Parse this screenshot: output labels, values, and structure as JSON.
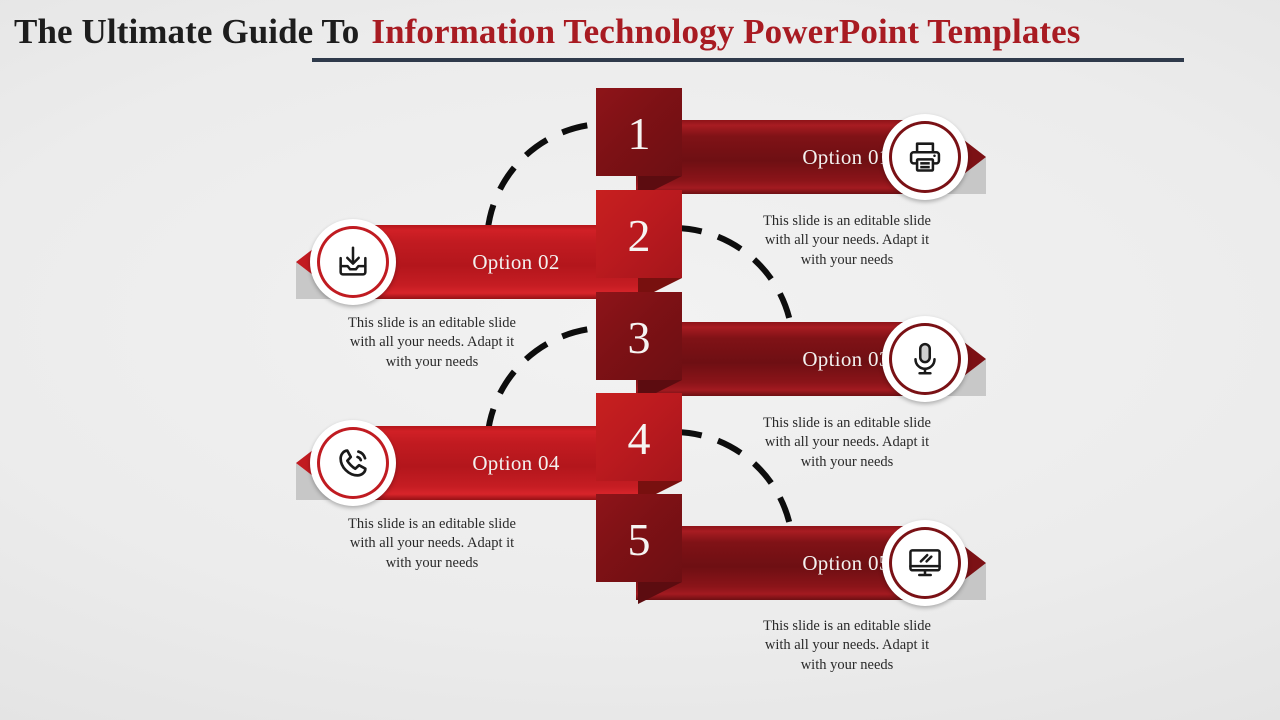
{
  "title": {
    "prefix": "The Ultimate Guide To",
    "accent": "Information Technology PowerPoint Templates",
    "prefix_color": "#1d1d1d",
    "accent_color": "#a81b22",
    "underline_color": "#2f3a4b"
  },
  "theme": {
    "background": "#ebebeb",
    "banner_dark_red": "#7c1115",
    "banner_bright_red": "#c21b21",
    "number_text_color": "#f6f4f2",
    "label_text_color": "#f3f1ef",
    "body_text_color": "#2a2a2a",
    "arc_color": "#0d0d0d"
  },
  "description_text": "This slide is an editable slide with all your needs. Adapt it with your needs",
  "steps": [
    {
      "number": "1",
      "label": "Option 01",
      "icon": "printer-icon",
      "side": "right",
      "tone": "dark",
      "description": "This slide is an editable slide with all your needs. Adapt it with your needs"
    },
    {
      "number": "2",
      "label": "Option 02",
      "icon": "download-inbox-icon",
      "side": "left",
      "tone": "bright",
      "description": "This slide is an editable slide with all your needs. Adapt it with your needs"
    },
    {
      "number": "3",
      "label": "Option 03",
      "icon": "microphone-icon",
      "side": "right",
      "tone": "dark",
      "description": "This slide is an editable slide with all your needs. Adapt it with your needs"
    },
    {
      "number": "4",
      "label": "Option 04",
      "icon": "phone-call-icon",
      "side": "left",
      "tone": "bright",
      "description": "This slide is an editable slide with all your needs. Adapt it with your needs"
    },
    {
      "number": "5",
      "label": "Option 05",
      "icon": "desktop-monitor-icon",
      "side": "right",
      "tone": "dark",
      "description": "This slide is an editable slide with all your needs. Adapt it with your needs"
    }
  ]
}
